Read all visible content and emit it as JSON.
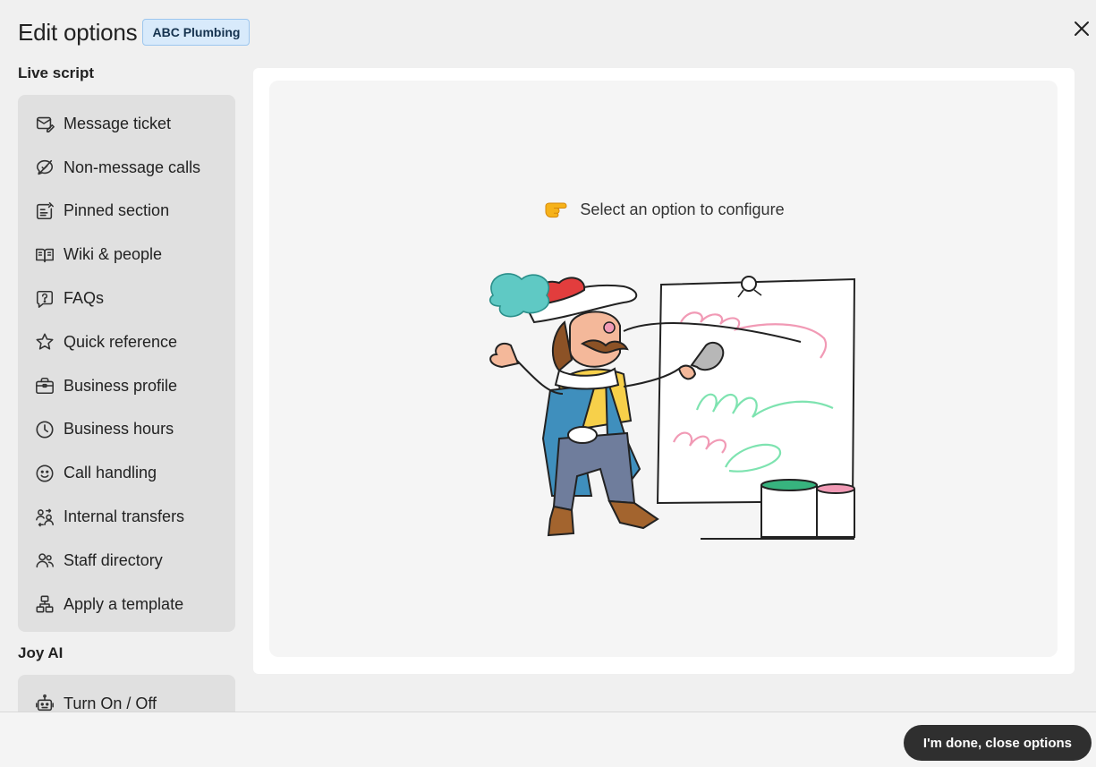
{
  "header": {
    "title": "Edit options",
    "badge": "ABC Plumbing"
  },
  "sections": {
    "live_script": {
      "title": "Live script",
      "items": [
        {
          "label": "Message ticket",
          "icon": "envelope-edit-icon"
        },
        {
          "label": "Non-message calls",
          "icon": "no-message-icon"
        },
        {
          "label": "Pinned section",
          "icon": "pinned-note-icon"
        },
        {
          "label": "Wiki & people",
          "icon": "book-icon"
        },
        {
          "label": "FAQs",
          "icon": "question-bubble-icon"
        },
        {
          "label": "Quick reference",
          "icon": "star-icon"
        },
        {
          "label": "Business profile",
          "icon": "briefcase-icon"
        },
        {
          "label": "Business hours",
          "icon": "clock-icon"
        },
        {
          "label": "Call handling",
          "icon": "smiley-icon"
        },
        {
          "label": "Internal transfers",
          "icon": "transfer-people-icon"
        },
        {
          "label": "Staff directory",
          "icon": "people-icon"
        },
        {
          "label": "Apply a template",
          "icon": "template-icon"
        }
      ]
    },
    "joy_ai": {
      "title": "Joy AI",
      "items": [
        {
          "label": "Turn On / Off",
          "icon": "robot-icon"
        }
      ]
    }
  },
  "main": {
    "prompt": "Select an option to configure",
    "prompt_icon": "pointing-hand-icon"
  },
  "footer": {
    "done_label": "I'm done, close options"
  },
  "colors": {
    "badge_bg": "#d8eafb",
    "menu_bg": "#e0e0e0",
    "done_button_bg": "#2f2f2f"
  }
}
